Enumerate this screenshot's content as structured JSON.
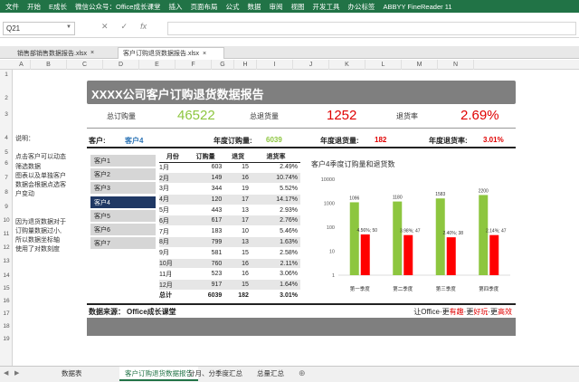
{
  "ribbon": {
    "tabs": [
      "文件",
      "开始",
      "E成长",
      "微信公众号：Office成长课堂",
      "插入",
      "页面布局",
      "公式",
      "数据",
      "审阅",
      "视图",
      "开发工具",
      "办公标签",
      "ABBYY FineReader 11"
    ]
  },
  "formula_bar": {
    "cell_ref": "Q21",
    "fx": "fx",
    "value": ""
  },
  "file_tabs": [
    {
      "label": "销售部销售数据报告.xlsx",
      "close": "×",
      "active": false
    },
    {
      "label": "客户订购退货数据报告.xlsx",
      "close": "×",
      "active": true
    }
  ],
  "columns": [
    "A",
    "B",
    "C",
    "D",
    "E",
    "F",
    "G",
    "H",
    "I",
    "J",
    "K",
    "L",
    "M",
    "N"
  ],
  "rows": [
    "1",
    "2",
    "3",
    "4",
    "5",
    "6",
    "7",
    "8",
    "9",
    "10",
    "11",
    "12",
    "13",
    "14",
    "15",
    "16",
    "17",
    "18",
    "19",
    "20",
    "21",
    "22",
    "23",
    "24",
    "25"
  ],
  "report": {
    "title": "XXXX公司客户订购退货数据报告",
    "kpi": {
      "order_label": "总订购量",
      "order_value": "46522",
      "return_label": "总退货量",
      "return_value": "1252",
      "rate_label": "退货率",
      "rate_value": "2.69%"
    },
    "notes": [
      "说明：",
      "",
      "点击客户可以动态",
      "筛选数据",
      "图表以及单独客户",
      "数据会根据点选客",
      "户变动",
      "",
      "",
      "因为退货数据对于",
      "订购量数据过小,",
      "所以数据坐标轴",
      "使用了对数刻度"
    ],
    "info": {
      "cust_label": "客户:",
      "cust_value": "客户4",
      "annual_order_label": "年度订购量:",
      "annual_order_value": "6039",
      "annual_return_label": "年度退货量:",
      "annual_return_value": "182",
      "annual_rate_label": "年度退货率:",
      "annual_rate_value": "3.01%"
    },
    "customers": [
      "客户1",
      "客户2",
      "客户3",
      "客户4",
      "客户5",
      "客户6",
      "客户7"
    ],
    "selected_customer": "客户4",
    "table": {
      "headers": [
        "月份",
        "订购量",
        "退货",
        "退货率"
      ],
      "rows": [
        [
          "1月",
          "603",
          "15",
          "2.49%"
        ],
        [
          "2月",
          "149",
          "16",
          "10.74%"
        ],
        [
          "3月",
          "344",
          "19",
          "5.52%"
        ],
        [
          "4月",
          "120",
          "17",
          "14.17%"
        ],
        [
          "5月",
          "443",
          "13",
          "2.93%"
        ],
        [
          "6月",
          "617",
          "17",
          "2.76%"
        ],
        [
          "7月",
          "183",
          "10",
          "5.46%"
        ],
        [
          "8月",
          "799",
          "13",
          "1.63%"
        ],
        [
          "9月",
          "581",
          "15",
          "2.58%"
        ],
        [
          "10月",
          "760",
          "16",
          "2.11%"
        ],
        [
          "11月",
          "523",
          "16",
          "3.06%"
        ],
        [
          "12月",
          "917",
          "15",
          "1.64%"
        ]
      ],
      "total": [
        "总计",
        "6039",
        "182",
        "3.01%"
      ]
    },
    "footer": {
      "source_label": "数据来源：",
      "source_value": "Office成长课堂",
      "slogan_a": "让Office·更",
      "slogan_b": "有趣",
      "slogan_c": "·更",
      "slogan_d": "好玩",
      "slogan_e": "·更",
      "slogan_f": "高效"
    }
  },
  "chart_data": {
    "type": "bar",
    "title": "客户4季度订购量和退货数",
    "categories": [
      "第一季度",
      "第二季度",
      "第三季度",
      "第四季度"
    ],
    "yscale": "log",
    "ylim": [
      1,
      10000
    ],
    "yticks": [
      "10000",
      "1000",
      "100",
      "10",
      "1"
    ],
    "series": [
      {
        "name": "订购量",
        "color": "#8dc63f",
        "values": [
          1096,
          1180,
          1583,
          2200
        ]
      },
      {
        "name": "退货",
        "color": "#ff0000",
        "values": [
          50,
          47,
          38,
          47
        ]
      }
    ],
    "labels": [
      "4.56%; 50",
      "3.98%; 47",
      "2.40%; 38",
      "2.14%; 47"
    ]
  },
  "sheet_tabs": [
    "数据表",
    "客户订购退货数据报告",
    "分月、分季度汇总",
    "总量汇总"
  ],
  "active_sheet": "客户订购退货数据报告",
  "colors": {
    "excel_green": "#217346",
    "accent_gray": "#7f7f7f",
    "kpi_green": "#8dc63f",
    "kpi_red": "#ff0000",
    "selected": "#1f3864"
  }
}
